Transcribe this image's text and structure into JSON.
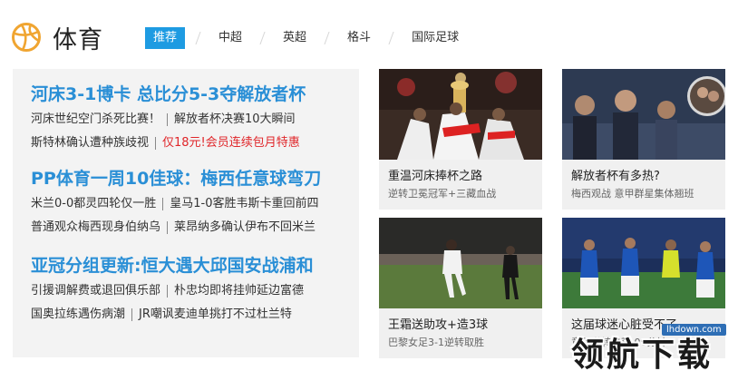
{
  "header": {
    "title": "体育",
    "tabs": [
      {
        "label": "推荐",
        "active": true
      },
      {
        "label": "中超",
        "active": false
      },
      {
        "label": "英超",
        "active": false
      },
      {
        "label": "格斗",
        "active": false
      },
      {
        "label": "国际足球",
        "active": false
      }
    ],
    "accent": "#1e9be2"
  },
  "news": [
    {
      "headline": "河床3-1博卡 总比分5-3夺解放者杯",
      "rows": [
        [
          "河床世纪空门杀死比赛！",
          "解放者杯决赛10大瞬间"
        ],
        [
          "斯特林确认遭种族歧视",
          "仅18元!会员连续包月特惠"
        ]
      ]
    },
    {
      "headline": "PP体育一周10佳球：梅西任意球弯刀",
      "rows": [
        [
          "米兰0-0都灵四轮仅一胜",
          "皇马1-0客胜韦斯卡重回前四"
        ],
        [
          "普通观众梅西现身伯纳乌",
          "莱昂纳多确认伊布不回米兰"
        ]
      ]
    },
    {
      "headline": "亚冠分组更新:恒大遇大邱国安战浦和",
      "rows": [
        [
          "引援调解费或退回俱乐部",
          "朴忠均即将挂帅延边富德"
        ],
        [
          "国奥拉练遇伤病潮",
          "JR嘲讽麦迪单挑打不过杜兰特"
        ]
      ]
    }
  ],
  "cards": [
    {
      "title": "重温河床捧杯之路",
      "subtitle": "逆转卫冕冠军+三藏血战"
    },
    {
      "title": "解放者杯有多热?",
      "subtitle": "梅西观战 意甲群星集体翘班"
    },
    {
      "title": "王霜送助攻+造3球",
      "subtitle": "巴黎女足3-1逆转取胜"
    },
    {
      "title": "这届球迷心脏受不了",
      "subtitle": "意甲逆转失利 09分钟"
    }
  ],
  "watermark": {
    "text": "领航下载",
    "url": "lhdown.com"
  }
}
